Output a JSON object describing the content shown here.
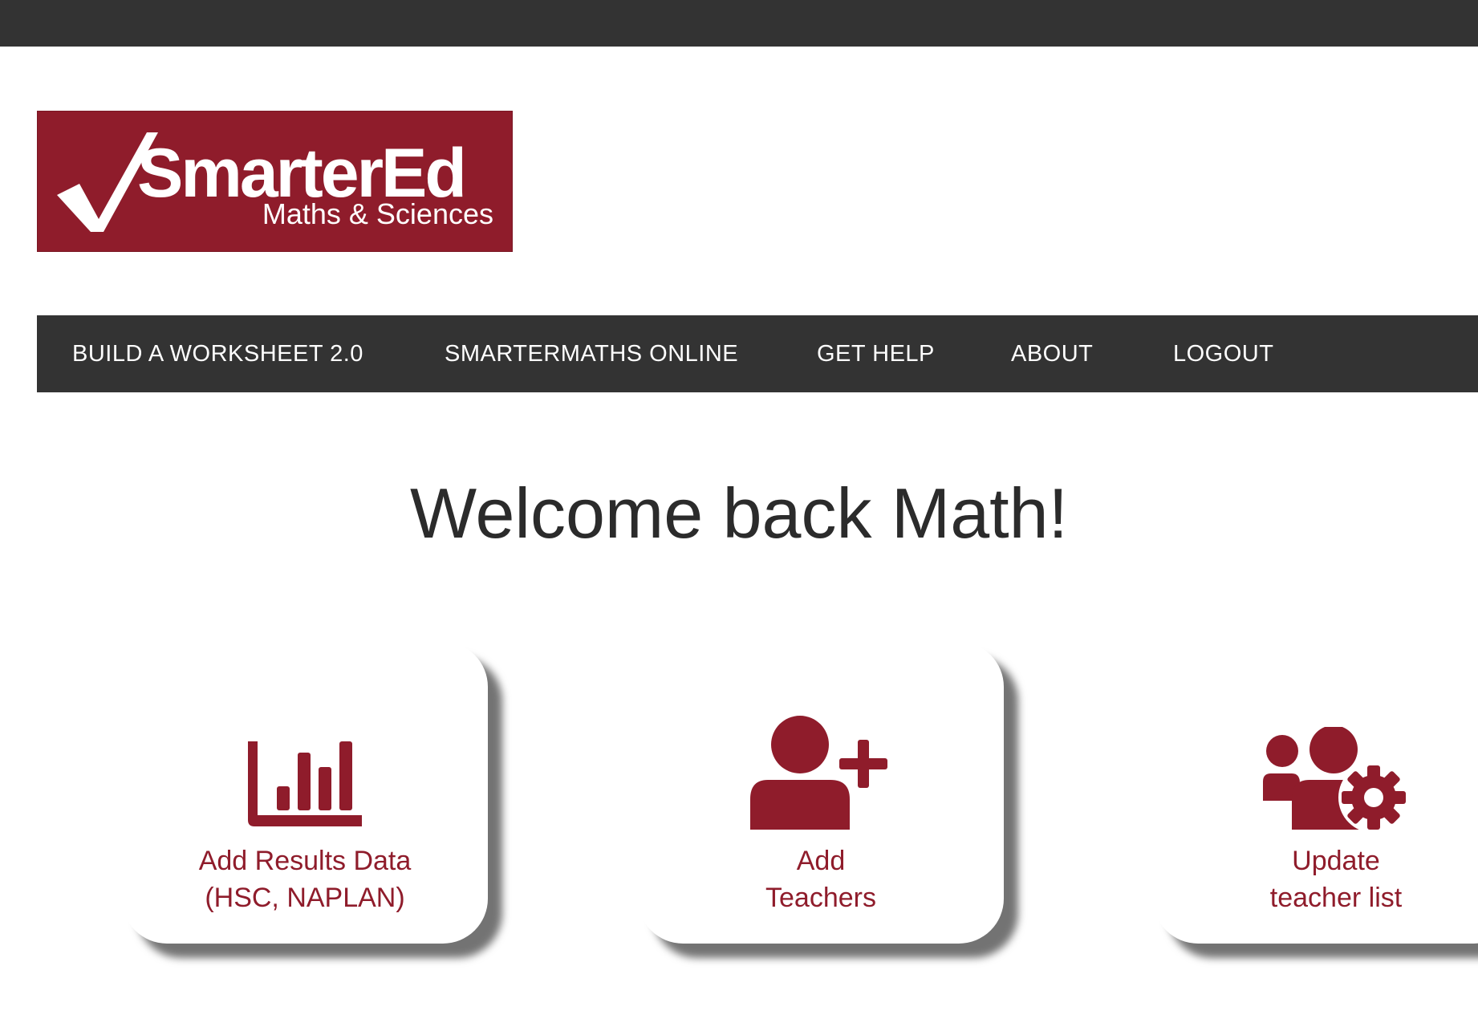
{
  "brand": {
    "name": "SmarterEd",
    "tagline": "Maths & Sciences",
    "color": "#8f1c2b"
  },
  "nav": {
    "items": [
      {
        "label": "BUILD A WORKSHEET 2.0"
      },
      {
        "label": "SMARTERMATHS ONLINE"
      },
      {
        "label": "GET HELP"
      },
      {
        "label": "ABOUT"
      },
      {
        "label": "LOGOUT"
      }
    ]
  },
  "main": {
    "welcome": "Welcome back Math!",
    "cards": [
      {
        "icon": "bar-chart-icon",
        "line1": "Add Results Data",
        "line2": "(HSC, NAPLAN)"
      },
      {
        "icon": "user-plus-icon",
        "line1": "Add",
        "line2": "Teachers"
      },
      {
        "icon": "users-gear-icon",
        "line1": "Update",
        "line2": "teacher list"
      }
    ]
  },
  "colors": {
    "accent": "#8f1c2b",
    "dark": "#333333"
  }
}
